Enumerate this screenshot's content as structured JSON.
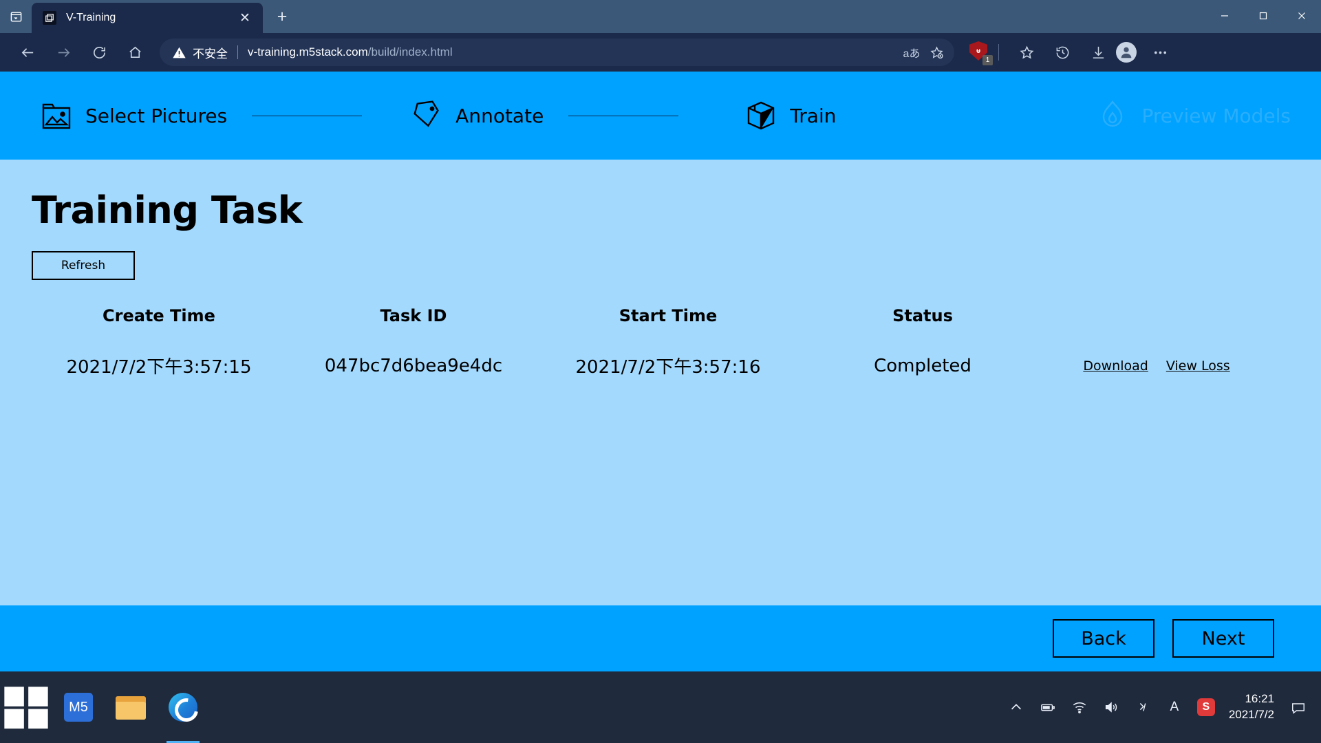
{
  "browser": {
    "tab": {
      "title": "V-Training",
      "favicon_icon": "window-icon",
      "close_icon": "close-icon"
    },
    "new_tab_label": "+",
    "system_menu_icon": "tab-actions-icon",
    "window_controls": {
      "minimize": "minimize-icon",
      "maximize": "maximize-icon",
      "close": "close-icon"
    },
    "nav": {
      "back_icon": "back-arrow-icon",
      "forward_icon": "forward-arrow-icon",
      "refresh_icon": "reload-icon",
      "home_icon": "home-icon"
    },
    "omnibox": {
      "security_warning_icon": "warning-triangle-icon",
      "security_label": "不安全",
      "url_host": "v-training.m5stack.com",
      "url_path": "/build/index.html",
      "translate_icon": "translate-icon",
      "translate_label": "aあ",
      "favorite_icon": "add-favorite-star-icon"
    },
    "toolbar": {
      "extension_icon": "ublock-shield-icon",
      "extension_badge": "1",
      "collections_icon": "collections-icon",
      "history_icon": "history-icon",
      "downloads_icon": "downloads-icon",
      "profile_icon": "profile-avatar-icon",
      "settings_icon": "more-options-icon"
    }
  },
  "app": {
    "steps": [
      {
        "label": "Select Pictures",
        "icon": "picture-folder-icon",
        "state": "done"
      },
      {
        "label": "Annotate",
        "icon": "tag-icon",
        "state": "done"
      },
      {
        "label": "Train",
        "icon": "box-icon",
        "state": "active"
      },
      {
        "label": "Preview Models",
        "icon": "flame-icon",
        "state": "disabled"
      }
    ],
    "page_title": "Training Task",
    "refresh_label": "Refresh",
    "table": {
      "columns": [
        "Create Time",
        "Task ID",
        "Start Time",
        "Status"
      ],
      "rows": [
        {
          "create_time": "2021/7/2下午3:57:15",
          "task_id": "047bc7d6bea9e4dc",
          "start_time": "2021/7/2下午3:57:16",
          "status": "Completed",
          "download_label": "Download",
          "view_loss_label": "View Loss"
        }
      ]
    },
    "footer": {
      "back_label": "Back",
      "next_label": "Next"
    },
    "colors": {
      "accent": "#00a2ff",
      "page_bg": "#a3d9fd",
      "disabled_step": "#2aaefc"
    }
  },
  "taskbar": {
    "start_icon": "windows-start-icon",
    "items": [
      {
        "name": "m5stack-app",
        "icon": "m5-icon"
      },
      {
        "name": "file-explorer",
        "icon": "folder-icon"
      },
      {
        "name": "microsoft-edge",
        "icon": "edge-icon"
      }
    ],
    "tray": {
      "chevron_icon": "show-hidden-icons-icon",
      "battery_icon": "battery-icon",
      "network_icon": "wifi-icon",
      "volume_icon": "volume-icon",
      "onedrive_icon": "sync-icon",
      "ime_label": "A",
      "sogou_label": "S",
      "time": "16:21",
      "date": "2021/7/2",
      "action_center_icon": "notifications-icon"
    }
  }
}
